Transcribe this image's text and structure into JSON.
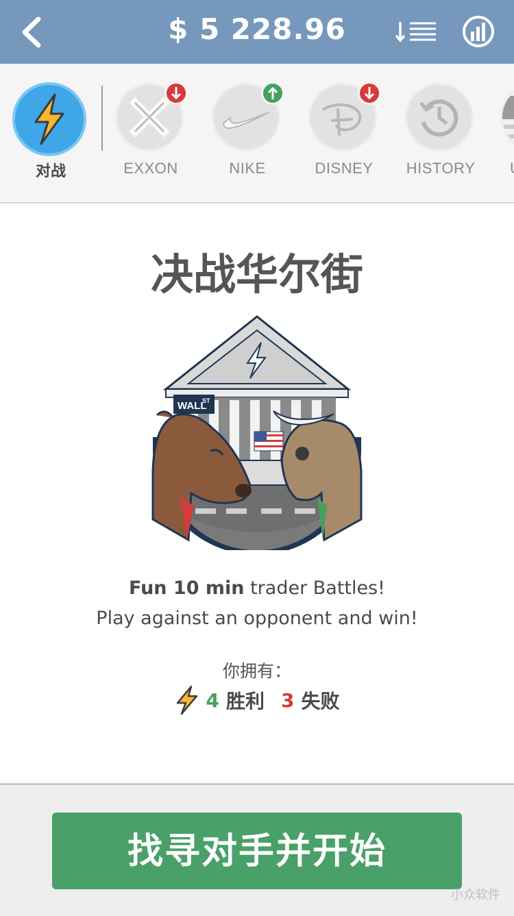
{
  "header": {
    "balance": "$ 5 228.96"
  },
  "ticker": {
    "items": [
      {
        "label": "对战",
        "icon": "lightning-icon",
        "active": true
      },
      {
        "label": "EXXON",
        "icon": "exxon-logo-icon",
        "trend": "down"
      },
      {
        "label": "NIKE",
        "icon": "nike-logo-icon",
        "trend": "up"
      },
      {
        "label": "DISNEY",
        "icon": "disney-logo-icon",
        "trend": "down"
      },
      {
        "label": "HISTORY",
        "icon": "history-icon"
      },
      {
        "label": "U",
        "icon": "us-flag-icon"
      }
    ]
  },
  "main": {
    "title": "决战华尔街",
    "hero_sign": "WALL",
    "hero_sign_sup": "ST",
    "tagline_bold": "Fun 10 min",
    "tagline_rest": " trader Battles!",
    "tagline2": "Play against an opponent and win!",
    "have_label": "你拥有：",
    "wins": "4",
    "wins_label": "胜利",
    "losses": "3",
    "losses_label": "失败"
  },
  "footer": {
    "start_label": "找寻对手并开始",
    "watermark": "小众软件"
  },
  "colors": {
    "header_bg": "#7698bd",
    "accent_green": "#4aa069",
    "win_green": "#47a05d",
    "loss_red": "#d63a3a",
    "battle_blue": "#3fa7e8"
  }
}
